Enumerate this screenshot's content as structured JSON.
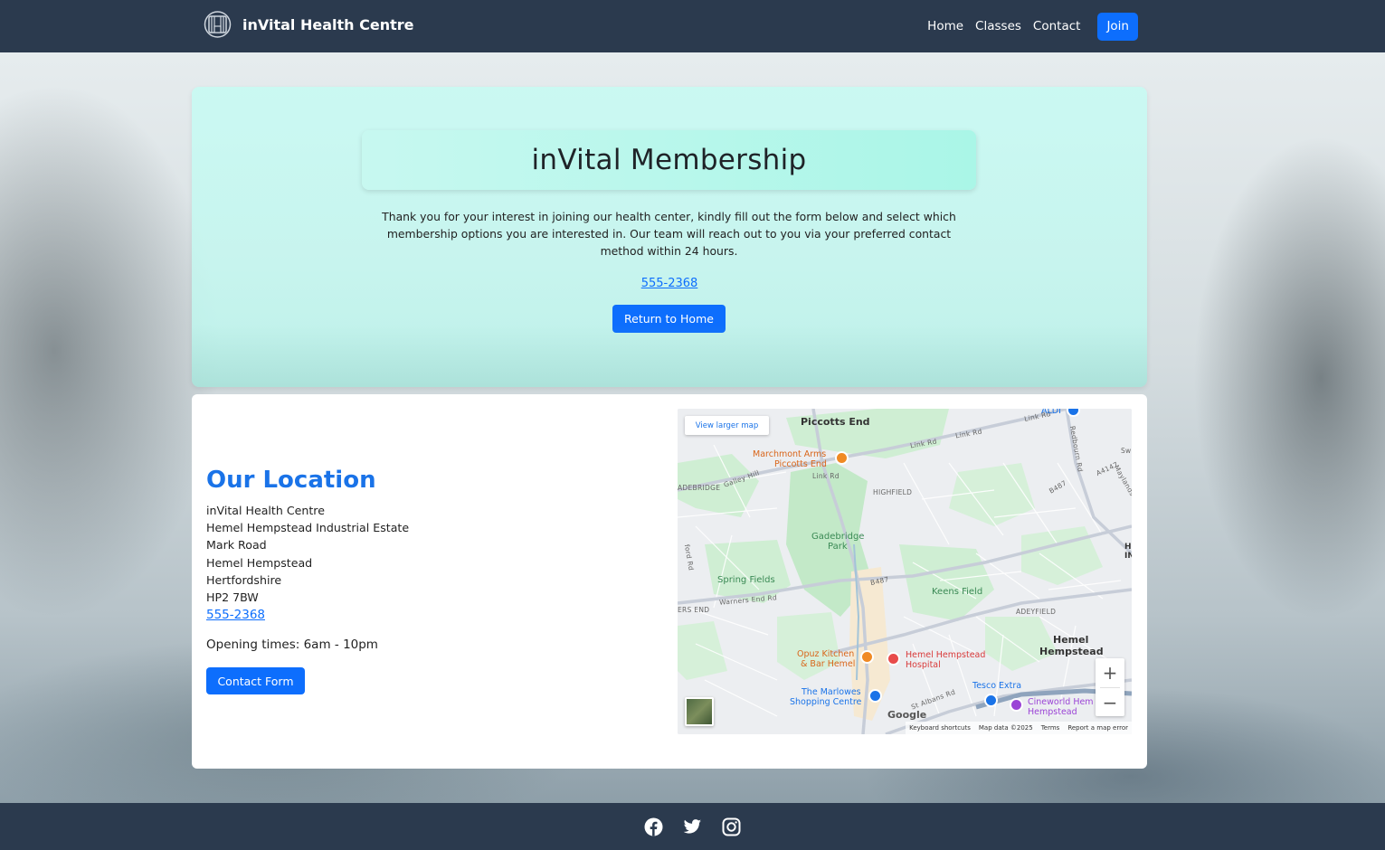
{
  "header": {
    "brand": "inVital Health Centre",
    "nav": [
      "Home",
      "Classes",
      "Contact"
    ],
    "join_label": "Join"
  },
  "hero": {
    "title": "inVital Membership",
    "text": "Thank you for your interest in joining our health center, kindly fill out the form below and select which membership options you are interested in. Our team will reach out to you via your preferred contact method within 24 hours.",
    "phone": "555-2368",
    "return_label": "Return to Home"
  },
  "location": {
    "title": "Our Location",
    "address": [
      "inVital Health Centre",
      "Hemel Hempstead Industrial Estate",
      "Mark Road",
      "Hemel Hempstead",
      "Hertfordshire",
      "HP2 7BW"
    ],
    "phone": "555-2368",
    "opening": "Opening times: 6am - 10pm",
    "contact_label": "Contact Form"
  },
  "map": {
    "larger_map": "View larger map",
    "labels": {
      "piccotts_end": "Piccotts End",
      "marchmont_1": "Marchmont Arms",
      "marchmont_2": "Piccotts End",
      "link_rd_1": "Link Rd",
      "link_rd_2": "Link Rd",
      "link_rd_3": "Link Rd",
      "link_rd_4": "Link Rd",
      "aldi": "ALDI",
      "redbourn_rd": "Redbourn Rd",
      "a4147": "A4147",
      "maylands": "Maylands",
      "sw": "Sw",
      "b487_top": "B487",
      "adeybridge": "ADEBRIDGE",
      "galley_hill": "Galley Hill",
      "highfield": "HIGHFIELD",
      "gadebridge_1": "Gadebridge",
      "gadebridge_2": "Park",
      "spring_fields": "Spring Fields",
      "warners_end_rd": "Warners End Rd",
      "warners_end": "ERS END",
      "b487": "B487",
      "keens_field": "Keens Field",
      "adeyfield": "ADEYFIELD",
      "ford_rd": "ford Rd",
      "hemel_1": "Hemel",
      "hemel_2": "Hempstead",
      "h_edge": "H",
      "in_edge": "IN",
      "opuz_1": "Opuz Kitchen",
      "opuz_2": "& Bar Hemel",
      "hospital_1": "Hemel Hempstead",
      "hospital_2": "Hospital",
      "marlowes_1": "The Marlowes",
      "marlowes_2": "Shopping Centre",
      "tesco": "Tesco Extra",
      "st_albans_rd": "St Albans Rd",
      "cineworld_1": "Cineworld Hem",
      "cineworld_2": "Hempstead"
    },
    "google": "Google",
    "footer": [
      "Keyboard shortcuts",
      "Map data ©2025",
      "Terms",
      "Report a map error"
    ],
    "zoom_in": "+",
    "zoom_out": "−"
  },
  "footer": {
    "social": [
      "facebook-icon",
      "twitter-icon",
      "instagram-icon"
    ]
  },
  "colors": {
    "nav_bg": "#2b3a4e",
    "primary": "#0d6efd",
    "heading_blue": "#1a73e8",
    "hero_bg": "#c8faf3"
  }
}
